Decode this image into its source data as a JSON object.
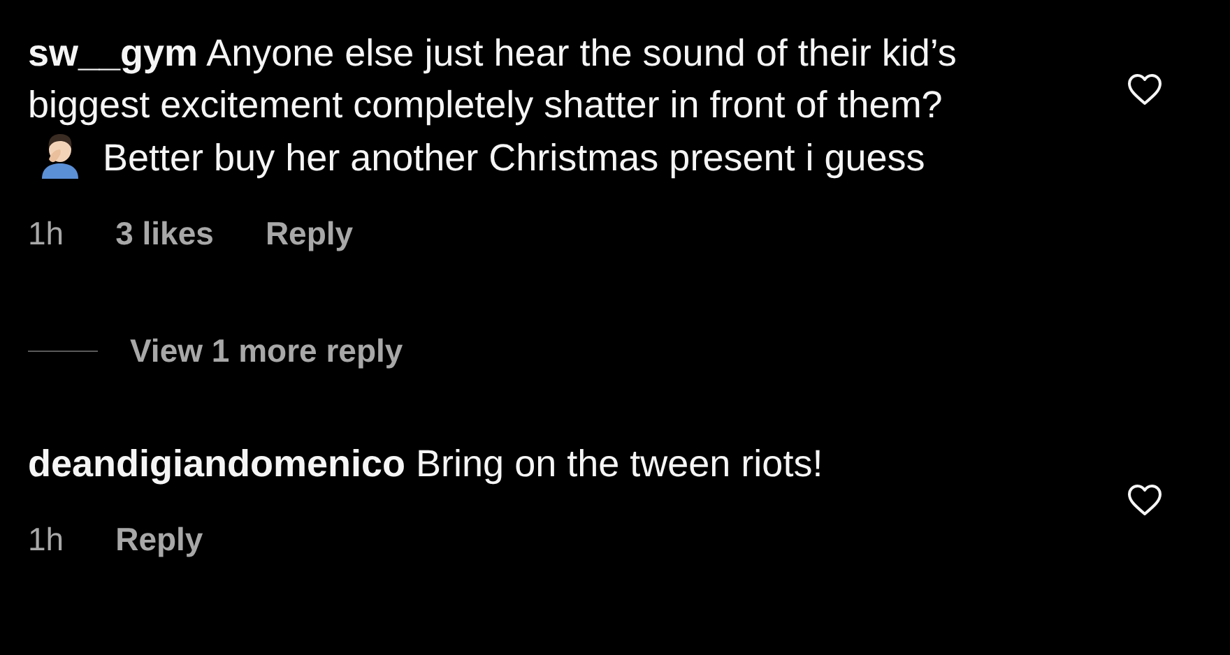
{
  "items": [
    {
      "kind": "comment",
      "username": "sw__gym",
      "segments": [
        {
          "kind": "text",
          "text": "Anyone else just hear the sound of their kid’s biggest excitement completely shatter in front of them?"
        },
        {
          "kind": "emoji"
        },
        {
          "kind": "text",
          "text": "Better buy her another Christmas present i guess"
        }
      ],
      "time": "1h",
      "likes": "3 likes",
      "reply": "Reply",
      "liked": false
    },
    {
      "kind": "view_replies",
      "text": "View 1 more reply"
    },
    {
      "kind": "comment",
      "username": "deandigiandomenico",
      "segments": [
        {
          "kind": "text",
          "text": "Bring on the tween riots!"
        }
      ],
      "time": "1h",
      "reply": "Reply",
      "liked": false
    }
  ]
}
